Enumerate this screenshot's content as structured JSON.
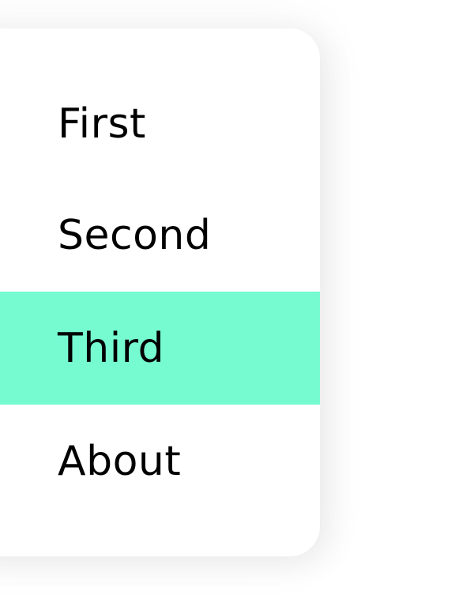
{
  "menu": {
    "items": [
      {
        "label": "First",
        "selected": false
      },
      {
        "label": "Second",
        "selected": false
      },
      {
        "label": "Third",
        "selected": true
      },
      {
        "label": "About",
        "selected": false
      }
    ],
    "highlight_color": "#76fbd0"
  }
}
